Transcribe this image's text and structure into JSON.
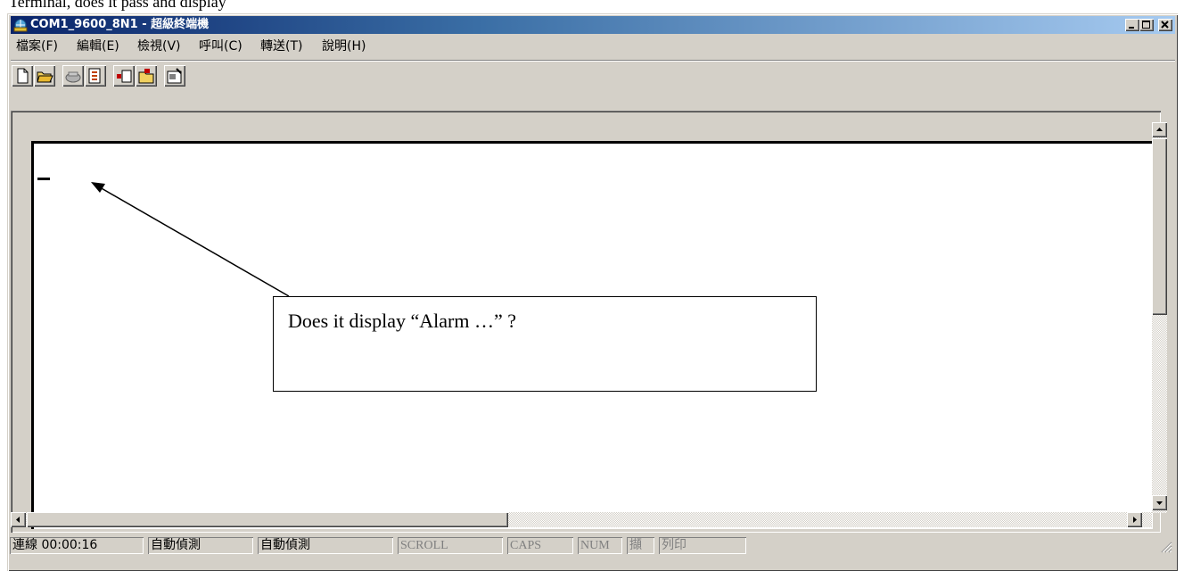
{
  "top_text": "Terminal, does it pass and display",
  "window": {
    "title": "COM1_9600_8N1 - 超級終端機",
    "controls": [
      "minimize",
      "maximize",
      "close"
    ]
  },
  "menu": [
    "檔案(F)",
    "編輯(E)",
    "檢視(V)",
    "呼叫(C)",
    "轉送(T)",
    "說明(H)"
  ],
  "toolbar": [
    "new-icon",
    "open-icon",
    "disconnect-icon",
    "connect-icon",
    "send-icon",
    "receive-icon",
    "properties-icon"
  ],
  "statusbar": {
    "connection": "連線 00:00:16",
    "detect1": "自動偵測",
    "detect2": "自動偵測",
    "scroll": "SCROLL",
    "caps": "CAPS",
    "num": "NUM",
    "capture": "擷",
    "print": "列印"
  },
  "annotation": {
    "text": "Does it display “Alarm …” ?"
  },
  "colors": {
    "title_active": "#0a246a",
    "face": "#d4d0c8"
  }
}
